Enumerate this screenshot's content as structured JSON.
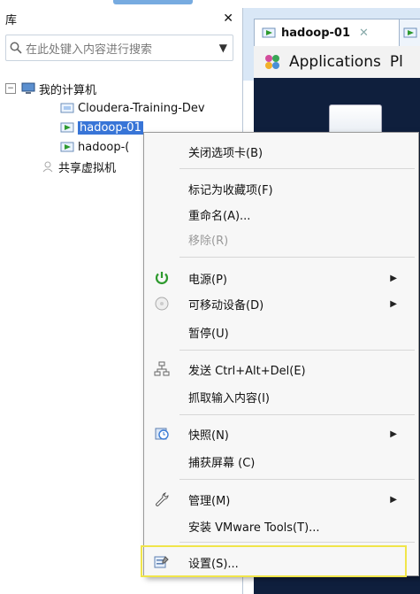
{
  "library": {
    "title": "库",
    "search_placeholder": "在此处键入内容进行搜索",
    "tree": {
      "root": "我的计算机",
      "children": [
        "Cloudera-Training-Dev",
        "hadoop-01",
        "hadoop-("
      ],
      "shared": "共享虚拟机"
    }
  },
  "tabs": {
    "tab1": "hadoop-01",
    "applications": "Applications",
    "pl": "Pl"
  },
  "menu": {
    "close_tab": "关闭选项卡(B)",
    "favorite": "标记为收藏项(F)",
    "rename": "重命名(A)...",
    "remove": "移除(R)",
    "power": "电源(P)",
    "removable": "可移动设备(D)",
    "pause": "暂停(U)",
    "send_cad": "发送 Ctrl+Alt+Del(E)",
    "grab_input": "抓取输入内容(I)",
    "snapshot": "快照(N)",
    "capture_screen": "捕获屏幕 (C)",
    "manage": "管理(M)",
    "install_tools": "安装 VMware Tools(T)...",
    "settings": "设置(S)..."
  },
  "colors": {
    "selection": "#3875d7",
    "highlight_box": "#f0e54a",
    "vm_background": "#0f1f3d",
    "power_icon": "#2e9a2e"
  }
}
